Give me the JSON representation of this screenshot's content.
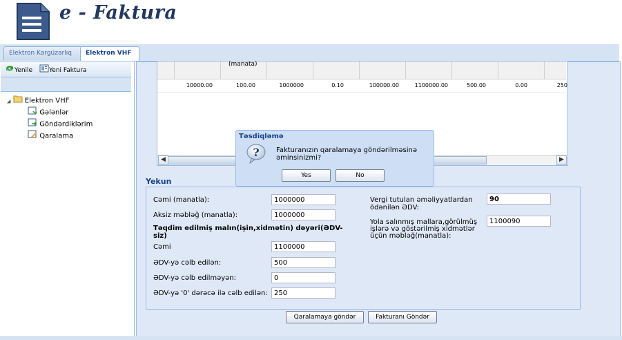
{
  "header": {
    "app_title": "e - Faktura"
  },
  "tabs": [
    {
      "label": "Elektron Kargüzarlıq",
      "active": false
    },
    {
      "label": "Elektron VHF",
      "active": true
    }
  ],
  "left_panel": {
    "toolbar": {
      "refresh_label": "Yenile",
      "new_invoice_label": "Yeni Faktura"
    },
    "tree": {
      "root": "Elektron VHF",
      "children": [
        "Gələnlər",
        "Göndərdiklərim",
        "Qaralama"
      ]
    }
  },
  "grid": {
    "header_fragment": "(manata)",
    "row": [
      "10000.00",
      "100.00",
      "1000000",
      "0.10",
      "100000.00",
      "1100000.00",
      "500.00",
      "0.00",
      "250"
    ]
  },
  "summary": {
    "title": "Yekun",
    "fields_left": [
      {
        "label": "Cəmi (manatla):",
        "value": "1000000"
      },
      {
        "label": "Aksiz məbləğ (manatla):",
        "value": "1000000"
      }
    ],
    "section_heading": "Təqdim edilmiş malın(işin,xidmətin) dəyəri(ƏDV-siz)",
    "fields_section": [
      {
        "label": "Cəmi",
        "value": "1100000"
      },
      {
        "label": "ƏDV-yə cəlb edilən:",
        "value": "500"
      },
      {
        "label": "ƏDV-yə cəlb edilməyən:",
        "value": "0"
      },
      {
        "label": "ƏDV-yə '0' dərəcə ilə cəlb edilən:",
        "value": "250"
      }
    ],
    "fields_right": [
      {
        "label": "Vergi tutulan əməliyyatlardan ödənilən ƏDV:",
        "value": "90"
      },
      {
        "label": "Yola salınmış mallara,görülmüş işlərə və göstərilmiş xidmətlər üçün məbləğ(manatla):",
        "value": "1100090"
      }
    ]
  },
  "buttons": {
    "draft_send": "Qaralamaya göndər",
    "invoice_send": "Fakturanı Göndər"
  },
  "dialog": {
    "title": "Təsdiqləmə",
    "message": "Fakturanızın qaralamaya göndərilməsinə əminsinizmi?",
    "yes": "Yes",
    "no": "No"
  },
  "colors": {
    "accent": "#15428b",
    "panel_bg": "#dfe8f6",
    "border": "#99bbe8"
  }
}
